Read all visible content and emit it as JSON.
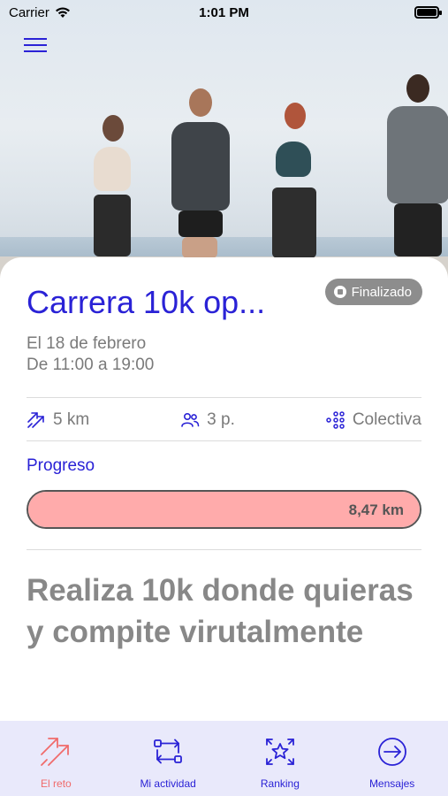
{
  "status_bar": {
    "carrier": "Carrier",
    "time": "1:01 PM"
  },
  "event": {
    "title": "Carrera 10k op...",
    "status_badge": "Finalizado",
    "date_line": "El 18 de febrero",
    "time_line": "De 11:00 a 19:00"
  },
  "stats": {
    "distance": "5 km",
    "participants": "3 p.",
    "type": "Colectiva"
  },
  "progress": {
    "label": "Progreso",
    "value": "8,47 km",
    "fraction": 1.0
  },
  "description": "Realiza 10k donde quieras y compite virutalmente",
  "tabs": [
    {
      "label": "El reto",
      "icon": "double-arrow-icon",
      "active": true
    },
    {
      "label": "Mi actividad",
      "icon": "activity-icon",
      "active": false
    },
    {
      "label": "Ranking",
      "icon": "ranking-star-icon",
      "active": false
    },
    {
      "label": "Mensajes",
      "icon": "arrow-circle-icon",
      "active": false
    }
  ],
  "colors": {
    "accent": "#2a22d6",
    "progress_fill": "#ffabab",
    "active_tab": "#f06b6b",
    "badge": "#8d8d8d",
    "tabbar_bg": "#e9e9fb"
  }
}
